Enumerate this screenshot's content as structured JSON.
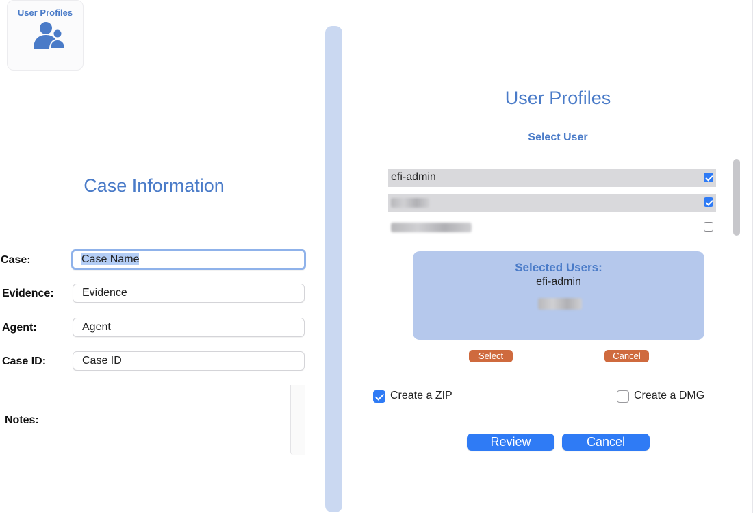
{
  "app_tile": {
    "title": "User Profiles",
    "icon": "user-profiles-icon"
  },
  "case": {
    "heading": "Case Information",
    "fields": [
      {
        "label": "Case:",
        "value": "Case Name"
      },
      {
        "label": "Evidence:",
        "value": "Evidence"
      },
      {
        "label": "Agent:",
        "value": "Agent"
      },
      {
        "label": "Case ID:",
        "value": "Case ID"
      }
    ],
    "notes_label": "Notes:"
  },
  "profiles": {
    "heading": "User Profiles",
    "select_label": "Select User",
    "users": [
      {
        "name": "efi-admin",
        "checked": true
      },
      {
        "name": "",
        "checked": true,
        "redacted": true
      },
      {
        "name": "",
        "checked": false,
        "redacted": true
      }
    ],
    "selected_box": {
      "title": "Selected Users:",
      "users": [
        "efi-admin"
      ]
    },
    "select_button": "Select",
    "cancel_small_button": "Cancel",
    "options": {
      "zip_label": "Create a ZIP",
      "zip_checked": true,
      "dmg_label": "Create a DMG",
      "dmg_checked": false
    },
    "review_button": "Review",
    "cancel_button": "Cancel"
  },
  "colors": {
    "accent": "#4a7bc8",
    "primary_button": "#2f7bf5",
    "secondary_button": "#cf6a3e",
    "divider": "#cad8f1",
    "selected_box": "#b5c8ec"
  }
}
